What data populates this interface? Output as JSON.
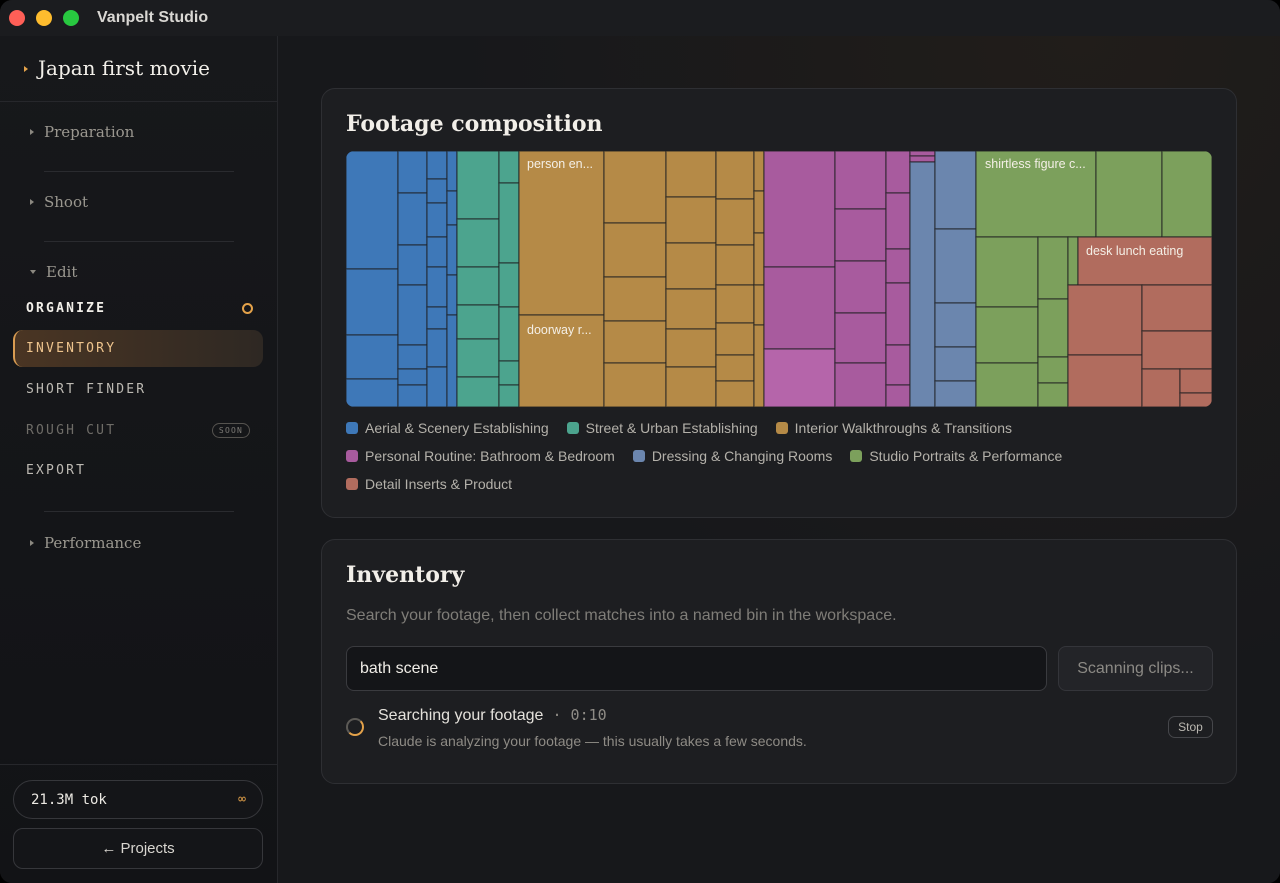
{
  "app": {
    "title": "Vanpelt Studio"
  },
  "sidebar": {
    "project_title": "Japan first movie",
    "sections": {
      "preparation": "Preparation",
      "shoot": "Shoot",
      "edit": "Edit",
      "performance": "Performance"
    },
    "nav": {
      "organize": "ORGANIZE",
      "inventory": "INVENTORY",
      "short_finder": "SHORT FINDER",
      "rough_cut": "ROUGH CUT",
      "rough_cut_badge": "SOON",
      "export": "EXPORT"
    },
    "tokens": {
      "value": "21.3M tok",
      "limit": "∞"
    },
    "projects_button": "← Projects"
  },
  "composition": {
    "title": "Footage composition",
    "labels": [
      "person en...",
      "doorway r...",
      "shirtless figure c...",
      "desk lunch eating"
    ],
    "legend": [
      {
        "name": "Aerial & Scenery Establishing",
        "color": "#3e78b8"
      },
      {
        "name": "Street & Urban Establishing",
        "color": "#4ca48e"
      },
      {
        "name": "Interior Walkthroughs & Transitions",
        "color": "#b58a47"
      },
      {
        "name": "Personal Routine: Bathroom & Bedroom",
        "color": "#a85b9e"
      },
      {
        "name": "Dressing & Changing Rooms",
        "color": "#6b86ae"
      },
      {
        "name": "Studio Portraits & Performance",
        "color": "#7ca05c"
      },
      {
        "name": "Detail Inserts & Product",
        "color": "#b16c5e"
      }
    ]
  },
  "inventory": {
    "title": "Inventory",
    "subtitle": "Search your footage, then collect matches into a named bin in the workspace.",
    "search_value": "bath scene",
    "scan_button": "Scanning clips...",
    "status_title": "Searching your footage",
    "status_sep": " · ",
    "status_time": "0:10",
    "status_sub": "Claude is analyzing your footage — this usually takes a few seconds.",
    "stop_button": "Stop"
  }
}
